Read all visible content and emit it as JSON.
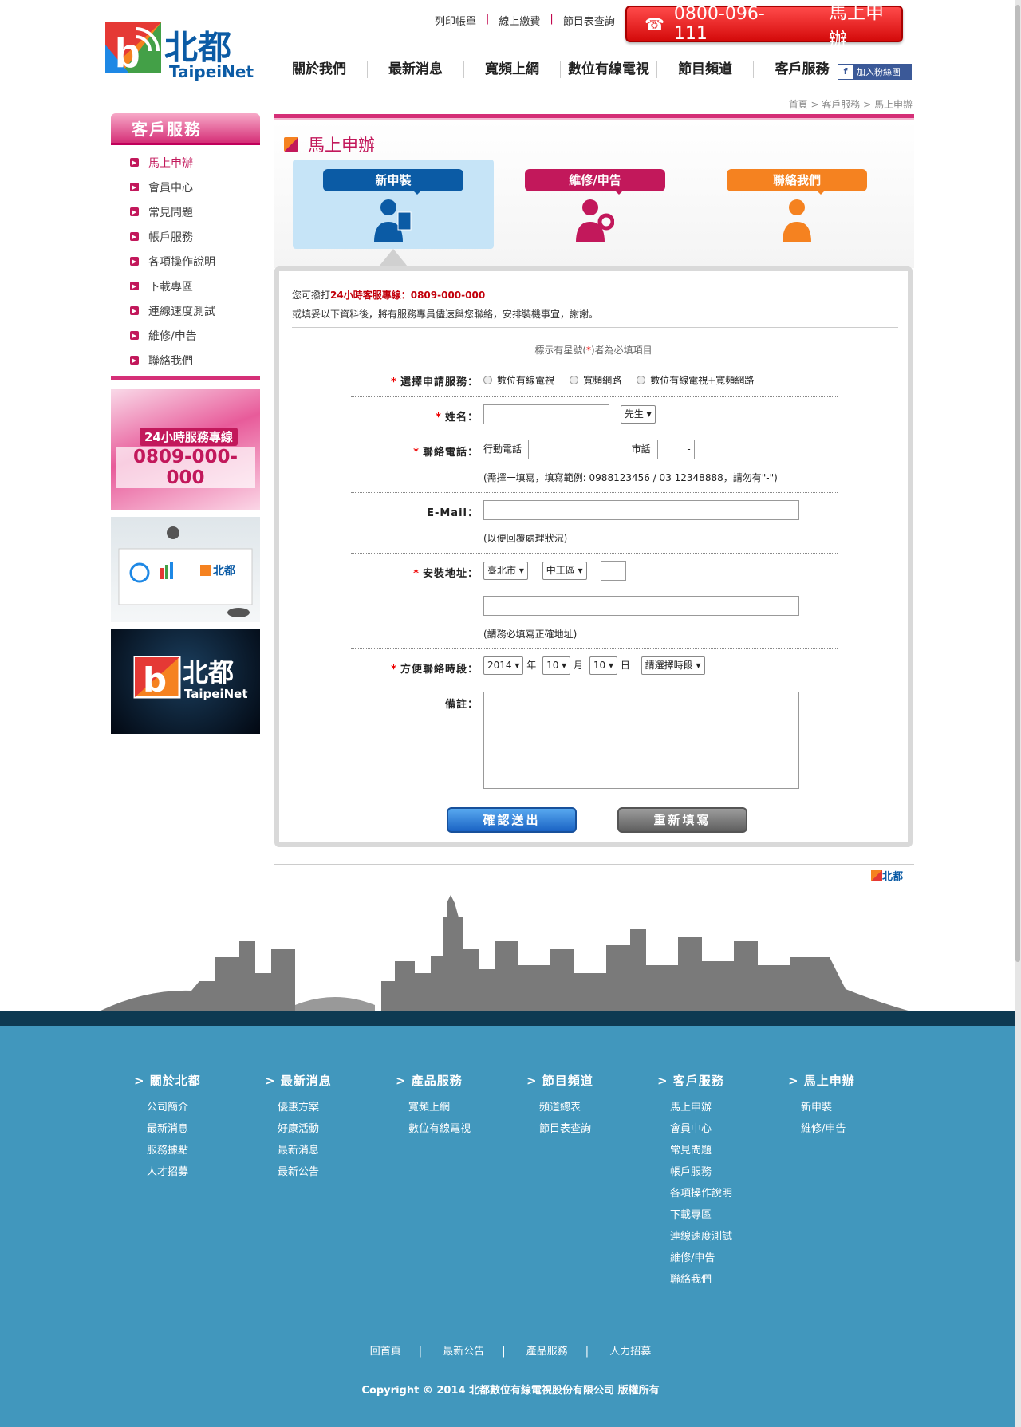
{
  "brand": {
    "name_cn": "北都",
    "name_en": "TaipeiNet"
  },
  "top_links": [
    "列印帳單",
    "線上繳費",
    "節目表查詢"
  ],
  "hotline_button": {
    "phone": "0800-096-111",
    "label": "馬上申辦"
  },
  "main_nav": [
    "關於我們",
    "最新消息",
    "寬頻上網",
    "數位有線電視",
    "節目頻道",
    "客戶服務"
  ],
  "facebook": {
    "label": "加入粉絲團"
  },
  "breadcrumb": "首頁 > 客戶服務 > 馬上申辦",
  "sidebar": {
    "title": "客戶服務",
    "items": [
      "馬上申辦",
      "會員中心",
      "常見問題",
      "帳戶服務",
      "各項操作說明",
      "下載專區",
      "連線速度測試",
      "維修/申告",
      "聯絡我們"
    ],
    "banner1": {
      "tag": "24小時服務專線",
      "number": "0809-000-000"
    }
  },
  "page_title": "馬上申辦",
  "tabs": [
    "新申裝",
    "維修/申告",
    "聯絡我們"
  ],
  "intro": {
    "line1_prefix": "您可撥打",
    "line1_hl": "24小時客服專線：0809-000-000",
    "line2": "或填妥以下資料後，將有服務專員儘速與您聯絡，安排裝機事宜，謝謝。"
  },
  "required_note": {
    "prefix": "標示有星號(",
    "star": "*",
    "suffix": ")者為必填項目"
  },
  "form": {
    "service": {
      "label": "選擇申請服務：",
      "options": [
        "數位有線電視",
        "寬頻網路",
        "數位有線電視+寬頻網路"
      ]
    },
    "name": {
      "label": "姓名：",
      "title_select": "先生"
    },
    "phone": {
      "label": "聯絡電話：",
      "mobile_label": "行動電話",
      "home_label": "市話",
      "dash": "-",
      "hint": "(需擇一填寫，填寫範例: 0988123456 / 03 12348888，請勿有\"-\")"
    },
    "email": {
      "label": "E-Mail：",
      "hint": "(以便回覆處理狀況)"
    },
    "address": {
      "label": "安裝地址：",
      "city": "臺北市",
      "district": "中正區",
      "hint": "(請務必填寫正確地址)"
    },
    "contact_time": {
      "label": "方便聯絡時段：",
      "year": "2014",
      "year_unit": "年",
      "month": "10",
      "month_unit": "月",
      "day": "10",
      "day_unit": "日",
      "slot": "請選擇時段"
    },
    "remarks": {
      "label": "備註："
    },
    "submit": "確認送出",
    "reset": "重新填寫"
  },
  "footer": {
    "columns": [
      {
        "title": "關於北都",
        "links": [
          "公司簡介",
          "最新消息",
          "服務據點",
          "人才招募"
        ]
      },
      {
        "title": "最新消息",
        "links": [
          "優惠方案",
          "好康活動",
          "最新消息",
          "最新公告"
        ]
      },
      {
        "title": "產品服務",
        "links": [
          "寬頻上網",
          "數位有線電視"
        ]
      },
      {
        "title": "節目頻道",
        "links": [
          "頻道總表",
          "節目表查詢"
        ]
      },
      {
        "title": "客戶服務",
        "links": [
          "馬上申辦",
          "會員中心",
          "常見問題",
          "帳戶服務",
          "各項操作說明",
          "下載專區",
          "連線速度測試",
          "維修/申告",
          "聯絡我們"
        ]
      },
      {
        "title": "馬上申辦",
        "links": [
          "新申裝",
          "維修/申告"
        ]
      }
    ],
    "bottom_links": [
      "回首頁",
      "最新公告",
      "產品服務",
      "人力招募"
    ],
    "copyright": "Copyright © 2014 北都數位有線電視股份有限公司 版權所有"
  },
  "colors": {
    "brand_pink": "#c2185b",
    "brand_blue": "#0b5ba5",
    "brand_orange": "#f58220",
    "footer_bg": "#4197bd"
  }
}
